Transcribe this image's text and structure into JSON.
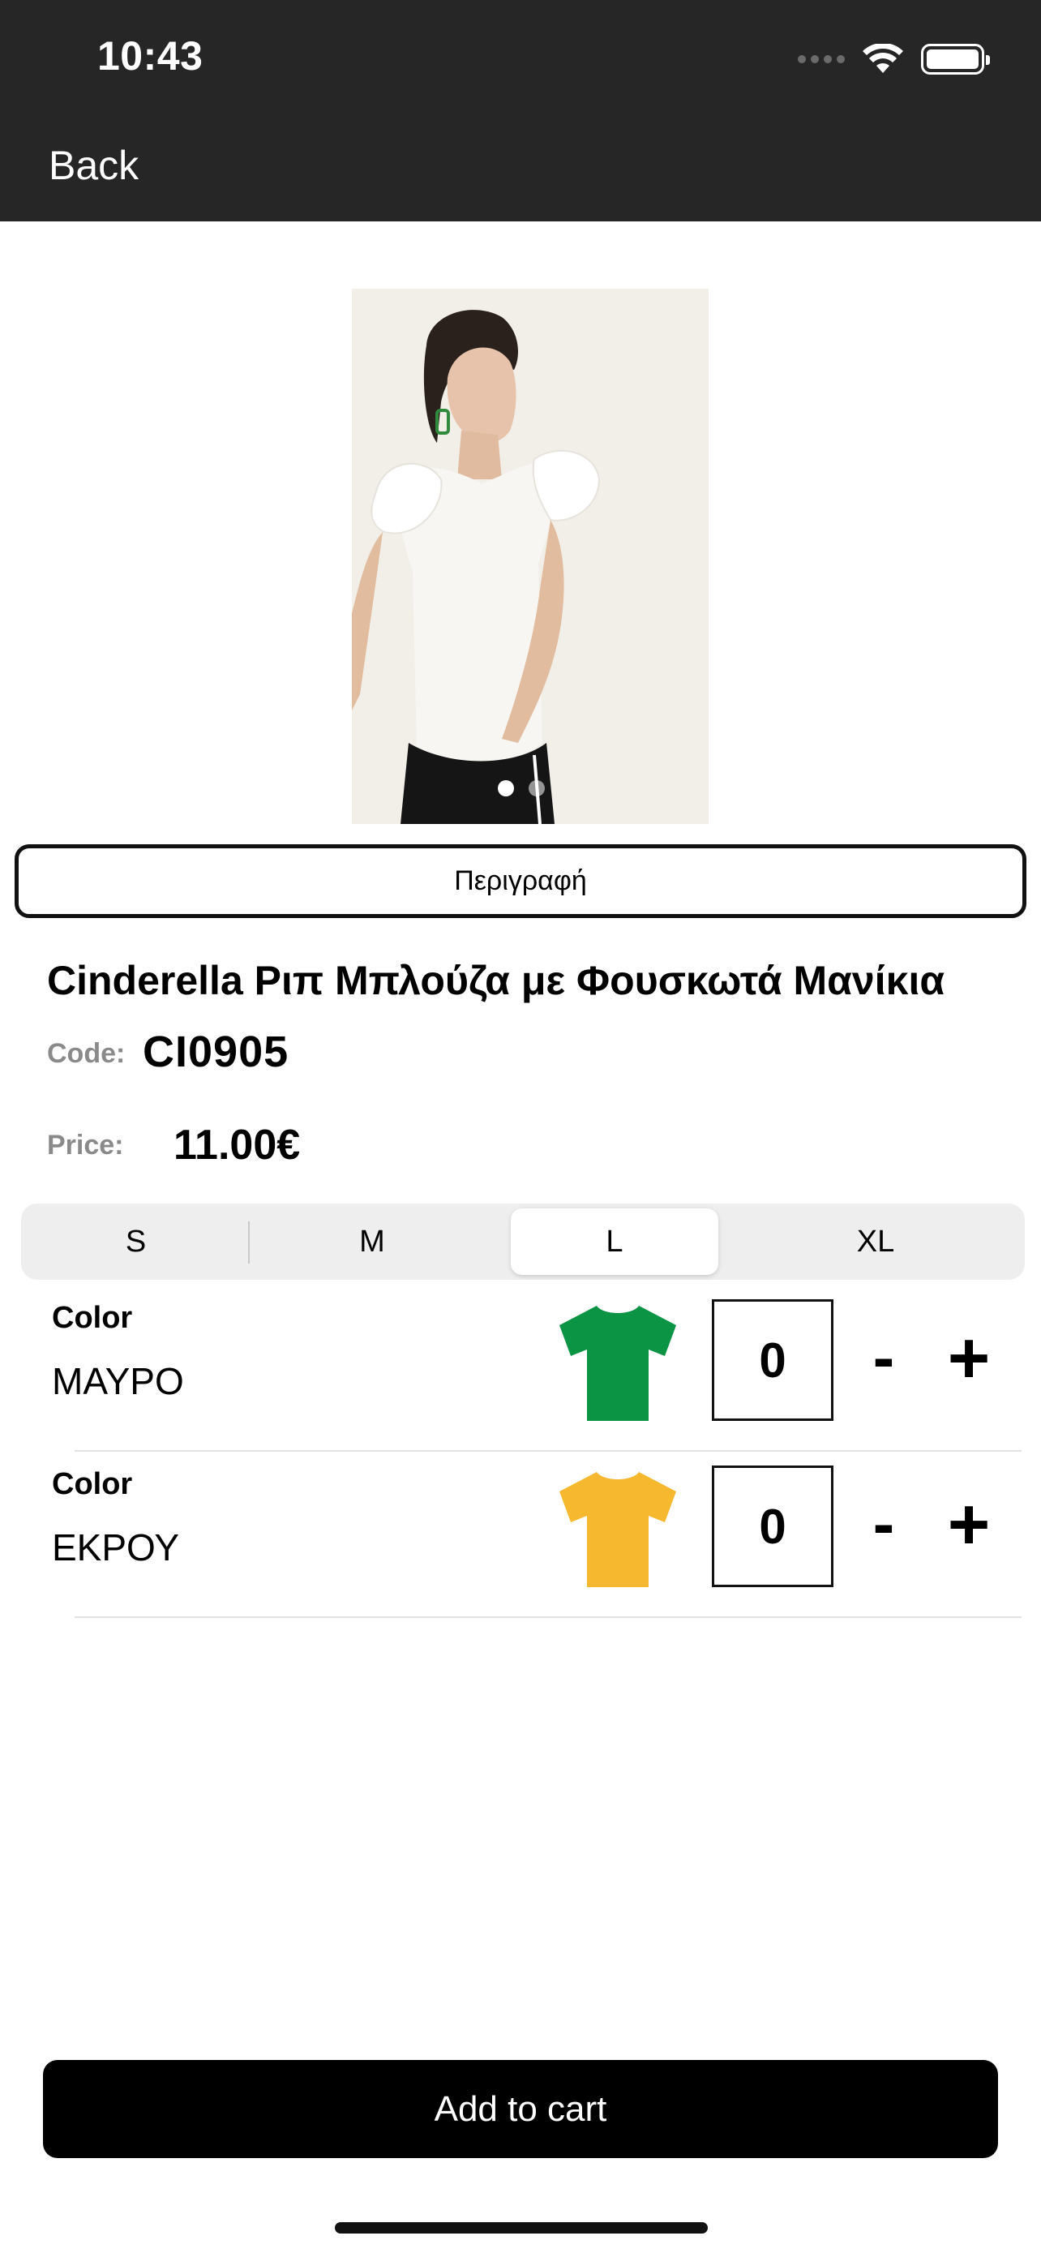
{
  "status": {
    "time": "10:43"
  },
  "nav": {
    "back_label": "Back"
  },
  "gallery": {
    "image_count": 2,
    "active_index": 0
  },
  "product": {
    "description_button": "Περιγραφή",
    "title": "Cinderella Ριπ Μπλούζα με Φουσκωτά Μανίκια",
    "code_label": "Code:",
    "code": "CI0905",
    "price_label": "Price:",
    "price": "11.00€"
  },
  "sizes": {
    "options": [
      "S",
      "M",
      "L",
      "XL"
    ],
    "selected": "L"
  },
  "colors": [
    {
      "label": "Color",
      "name": "ΜΑΥΡΟ",
      "swatch": "#0b9444",
      "icon": "tshirt-icon",
      "quantity": "0",
      "minus": "-",
      "plus": "+"
    },
    {
      "label": "Color",
      "name": "ΕΚΡΟΥ",
      "swatch": "#f5b82e",
      "icon": "tshirt-icon",
      "quantity": "0",
      "minus": "-",
      "plus": "+"
    }
  ],
  "cart": {
    "button_label": "Add to cart"
  },
  "theme": {
    "nav_bg": "#262626",
    "button_bg": "#000000"
  }
}
